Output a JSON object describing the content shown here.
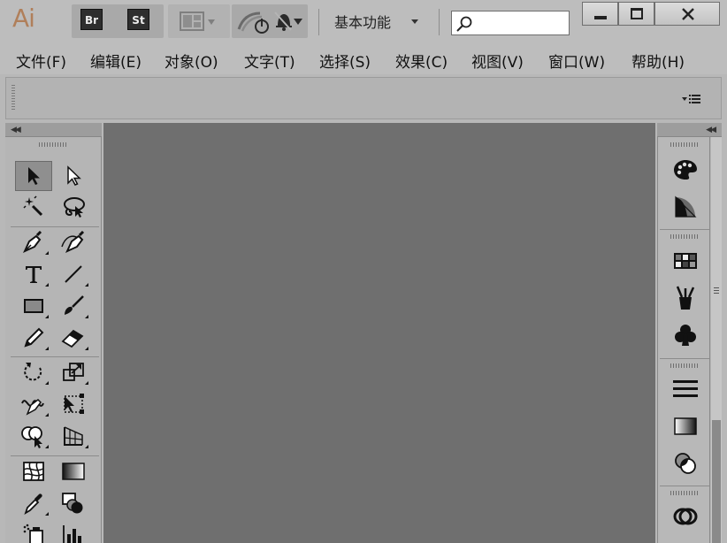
{
  "app": {
    "logo": "Ai"
  },
  "titlebar": {
    "bridge_label": "Br",
    "stock_label": "St",
    "workspace": "基本功能"
  },
  "search": {
    "value": "",
    "placeholder": ""
  },
  "menus": [
    "文件(F)",
    "编辑(E)",
    "对象(O)",
    "文字(T)",
    "选择(S)",
    "效果(C)",
    "视图(V)",
    "窗口(W)",
    "帮助(H)"
  ],
  "tools": [
    "selection-tool",
    "direct-selection-tool",
    "magic-wand-tool",
    "lasso-tool",
    "pen-tool",
    "curvature-tool",
    "type-tool",
    "line-segment-tool",
    "rectangle-tool",
    "paintbrush-tool",
    "pencil-tool",
    "eraser-tool",
    "rotate-tool",
    "scale-tool",
    "warp-tool",
    "free-transform-tool",
    "shape-builder-tool",
    "perspective-grid-tool",
    "mesh-tool",
    "gradient-tool",
    "eyedropper-tool",
    "blend-tool",
    "symbol-sprayer-tool",
    "column-graph-tool"
  ],
  "dock_panels": [
    "color-panel",
    "color-guide-panel",
    "swatches-panel",
    "brushes-panel",
    "symbols-panel",
    "stroke-panel",
    "gradient-panel",
    "transparency-panel",
    "appearance-panel"
  ],
  "colors": {
    "ui_bg": "#bdbdbd",
    "canvas": "#6f6f6f",
    "logo": "#b07f5a",
    "badge": "#2e2e2e"
  }
}
